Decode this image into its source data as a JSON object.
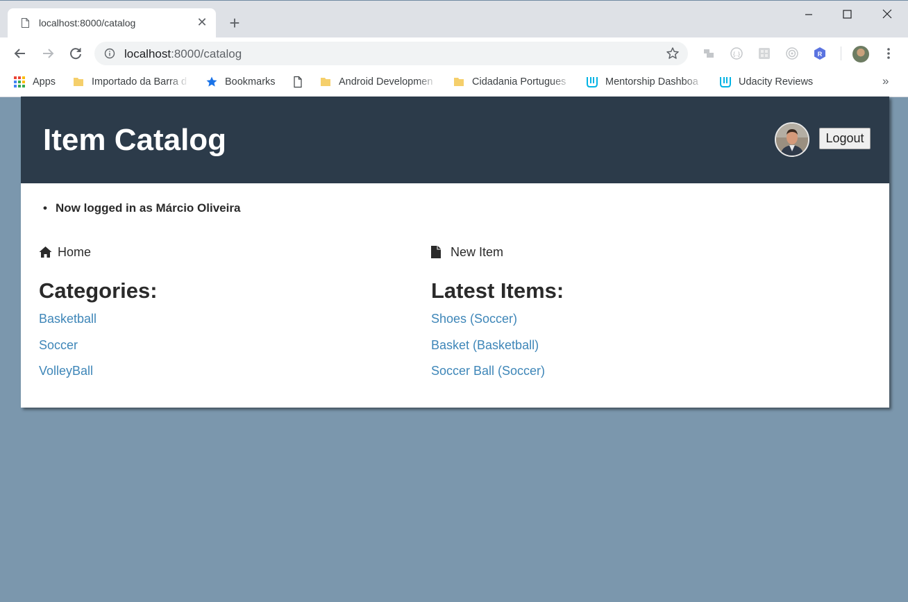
{
  "browser": {
    "tab_title": "localhost:8000/catalog",
    "url_host": "localhost",
    "url_path": ":8000/catalog",
    "bookmarks": {
      "apps": "Apps",
      "importado": "Importado da Barra d",
      "bookmarks": "Bookmarks",
      "android": "Android Developmen",
      "cidadania": "Cidadania Portugues",
      "mentorship": "Mentorship Dashboa",
      "udacity": "Udacity Reviews",
      "more": "»"
    },
    "extensions": [
      "folder-ext-icon",
      "json-ext-icon",
      "grid-ext-icon",
      "target-ext-icon",
      "r-ext-icon"
    ],
    "r_badge": "R"
  },
  "header": {
    "title": "Item Catalog",
    "logout_label": "Logout"
  },
  "flash": {
    "message": "Now logged in as Márcio Oliveira"
  },
  "nav": {
    "home_label": "Home",
    "new_item_label": "New Item"
  },
  "categories": {
    "title": "Categories:",
    "items": [
      "Basketball",
      "Soccer",
      "VolleyBall"
    ]
  },
  "latest": {
    "title": "Latest Items:",
    "items": [
      "Shoes (Soccer)",
      "Basket (Basketball)",
      "Soccer Ball (Soccer)"
    ]
  },
  "colors": {
    "header_bg": "#2c3b4a",
    "page_bg": "#7b97ad",
    "link": "#3e86b8"
  }
}
